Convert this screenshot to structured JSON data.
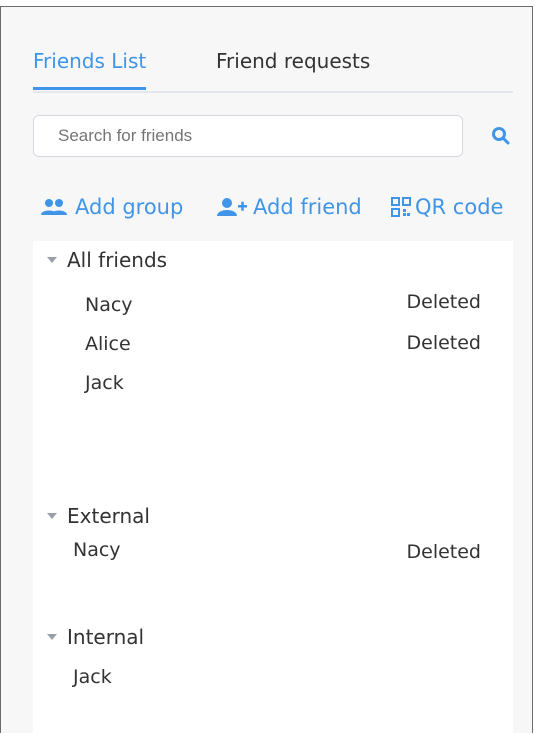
{
  "tabs": [
    {
      "label": "Friends List",
      "active": true
    },
    {
      "label": "Friend requests",
      "active": false
    }
  ],
  "search": {
    "placeholder": "Search for friends"
  },
  "actions": {
    "add_group": "Add group",
    "add_friend": "Add friend",
    "qr_code": "QR code"
  },
  "groups": [
    {
      "name": "All friends",
      "friends": [
        {
          "name": "Nacy",
          "status": "Deleted"
        },
        {
          "name": "Alice",
          "status": "Deleted"
        },
        {
          "name": "Jack",
          "status": ""
        }
      ]
    },
    {
      "name": "External",
      "friends": [
        {
          "name": "Nacy",
          "status": "Deleted"
        }
      ]
    },
    {
      "name": "Internal",
      "friends": [
        {
          "name": "Jack",
          "status": ""
        }
      ]
    }
  ],
  "colors": {
    "accent": "#3f95e8",
    "text": "#333333",
    "muted": "#9a9fa8"
  },
  "icons": [
    "search-icon",
    "add-group-icon",
    "add-friend-icon",
    "qr-code-icon",
    "caret-down-icon"
  ]
}
